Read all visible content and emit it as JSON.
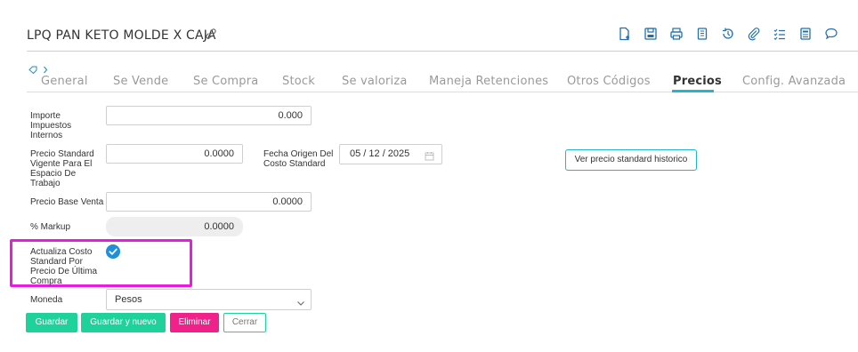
{
  "header": {
    "title": "LPQ PAN KETO MOLDE X CAJA"
  },
  "toolbar": {
    "icons": [
      "new-document-icon",
      "save-icon",
      "print-icon",
      "copy-icon",
      "history-icon",
      "attach-icon",
      "checklist-icon",
      "report-icon",
      "comment-icon"
    ]
  },
  "tabs": [
    {
      "label": "General"
    },
    {
      "label": "Se Vende"
    },
    {
      "label": "Se Compra"
    },
    {
      "label": "Stock"
    },
    {
      "label": "Se valoriza"
    },
    {
      "label": "Maneja Retenciones"
    },
    {
      "label": "Otros Códigos"
    },
    {
      "label": "Precios"
    },
    {
      "label": "Config. Avanzada"
    }
  ],
  "form": {
    "impuestos_label": "Importe Impuestos Internos",
    "impuestos_value": "0.000",
    "precio_std_label": "Precio Standard Vigente Para El Espacio De Trabajo",
    "precio_std_value": "0.0000",
    "fecha_label": "Fecha Origen Del Costo Standard",
    "fecha_value": "05 / 12 / 2025",
    "historico_button": "Ver precio standard historico",
    "precio_base_label": "Precio Base Venta",
    "precio_base_value": "0.0000",
    "markup_label": "% Markup",
    "markup_value": "0.0000",
    "actualiza_label": "Actualiza Costo Standard Por Precio De Última Compra",
    "actualiza_checked": true,
    "moneda_label": "Moneda",
    "moneda_value": "Pesos"
  },
  "actions": {
    "guardar": "Guardar",
    "guardar_nuevo": "Guardar y nuevo",
    "eliminar": "Eliminar",
    "cerrar": "Cerrar"
  },
  "colors": {
    "accent": "#1fb8c9",
    "green": "#1fd19b",
    "pink": "#f0218a",
    "highlight": "#e81be0",
    "check": "#1e8fd8"
  }
}
